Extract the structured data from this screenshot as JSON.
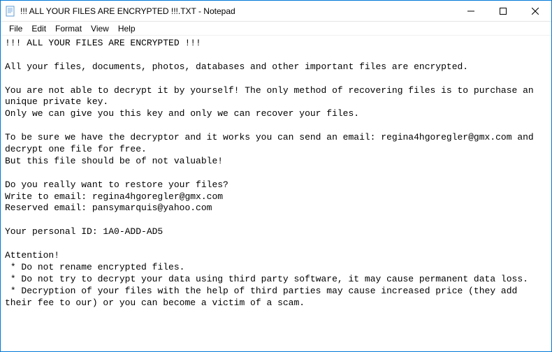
{
  "titlebar": {
    "title": "!!! ALL YOUR FILES ARE ENCRYPTED !!!.TXT - Notepad"
  },
  "menubar": {
    "file": "File",
    "edit": "Edit",
    "format": "Format",
    "view": "View",
    "help": "Help"
  },
  "content": {
    "text": "!!! ALL YOUR FILES ARE ENCRYPTED !!!\n\nAll your files, documents, photos, databases and other important files are encrypted.\n\nYou are not able to decrypt it by yourself! The only method of recovering files is to purchase an unique private key.\nOnly we can give you this key and only we can recover your files.\n\nTo be sure we have the decryptor and it works you can send an email: regina4hgoregler@gmx.com and decrypt one file for free.\nBut this file should be of not valuable!\n\nDo you really want to restore your files?\nWrite to email: regina4hgoregler@gmx.com\nReserved email: pansymarquis@yahoo.com\n\nYour personal ID: 1A0-ADD-AD5\n\nAttention!\n * Do not rename encrypted files.\n * Do not try to decrypt your data using third party software, it may cause permanent data loss.\n * Decryption of your files with the help of third parties may cause increased price (they add their fee to our) or you can become a victim of a scam."
  }
}
